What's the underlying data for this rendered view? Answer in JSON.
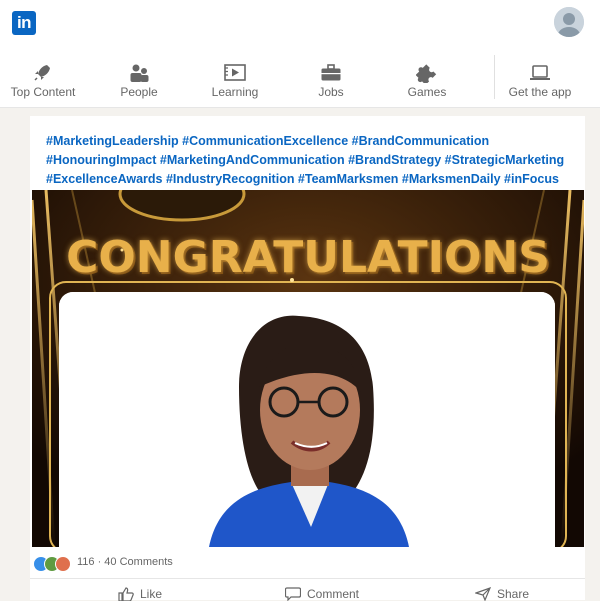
{
  "app": {
    "logo_text": "in",
    "brand_color": "#0a66c2"
  },
  "nav": {
    "items": [
      {
        "label": "Top Content",
        "icon": "rocket-icon"
      },
      {
        "label": "People",
        "icon": "people-icon"
      },
      {
        "label": "Learning",
        "icon": "play-icon"
      },
      {
        "label": "Jobs",
        "icon": "briefcase-icon"
      },
      {
        "label": "Games",
        "icon": "puzzle-icon"
      },
      {
        "label": "Get the app",
        "icon": "laptop-icon"
      }
    ]
  },
  "post": {
    "hashtag_lines": [
      "#MarketingLeadership #CommunicationExcellence #BrandCommunication",
      "#HonouringImpact #MarketingAndCommunication #BrandStrategy #StrategicMarketing",
      "#ExcellenceAwards #IndustryRecognition #TeamMarksmen #MarksmenDaily #inFocus"
    ],
    "banner_text": "CONGRATULATIONS",
    "reactions_text": "116 · 40 Comments",
    "actions": {
      "like": "Like",
      "comment": "Comment",
      "share": "Share"
    }
  }
}
